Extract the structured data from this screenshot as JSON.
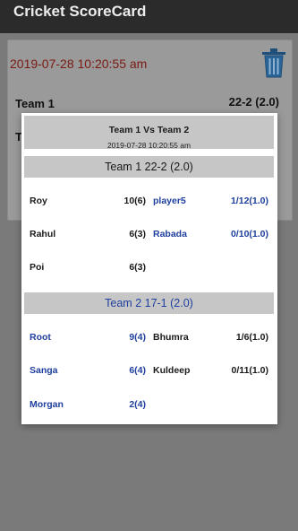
{
  "app": {
    "title": "Cricket ScoreCard"
  },
  "background_card": {
    "date": "2019-07-28 10:20:55 am",
    "team1_name": "Team 1",
    "team1_score": "22-2 (2.0)",
    "team2_partial": "T"
  },
  "dialog": {
    "title": "Team 1 Vs Team 2",
    "date": "2019-07-28 10:20:55 am",
    "innings": [
      {
        "header": "Team 1 22-2 (2.0)",
        "rows": [
          {
            "batsman": "Roy",
            "bat_score": "10(6)",
            "bowler": "player5",
            "bowl_fig": "1/12(1.0)"
          },
          {
            "batsman": "Rahul",
            "bat_score": "6(3)",
            "bowler": "Rabada",
            "bowl_fig": "0/10(1.0)"
          },
          {
            "batsman": "Poi",
            "bat_score": "6(3)",
            "bowler": "",
            "bowl_fig": ""
          }
        ]
      },
      {
        "header": "Team 2 17-1 (2.0)",
        "rows": [
          {
            "batsman": "Root",
            "bat_score": "9(4)",
            "bowler": "Bhumra",
            "bowl_fig": "1/6(1.0)"
          },
          {
            "batsman": "Sanga",
            "bat_score": "6(4)",
            "bowler": "Kuldeep",
            "bowl_fig": "0/11(1.0)"
          },
          {
            "batsman": "Morgan",
            "bat_score": "2(4)",
            "bowler": "",
            "bowl_fig": ""
          }
        ]
      }
    ]
  },
  "colors": {
    "appbar": "#2b2b2b",
    "date_red": "#7a1a12",
    "team_blue": "#1f3f9e",
    "section_gray": "#c6c6c6"
  },
  "icons": {
    "delete": "trash-icon"
  }
}
